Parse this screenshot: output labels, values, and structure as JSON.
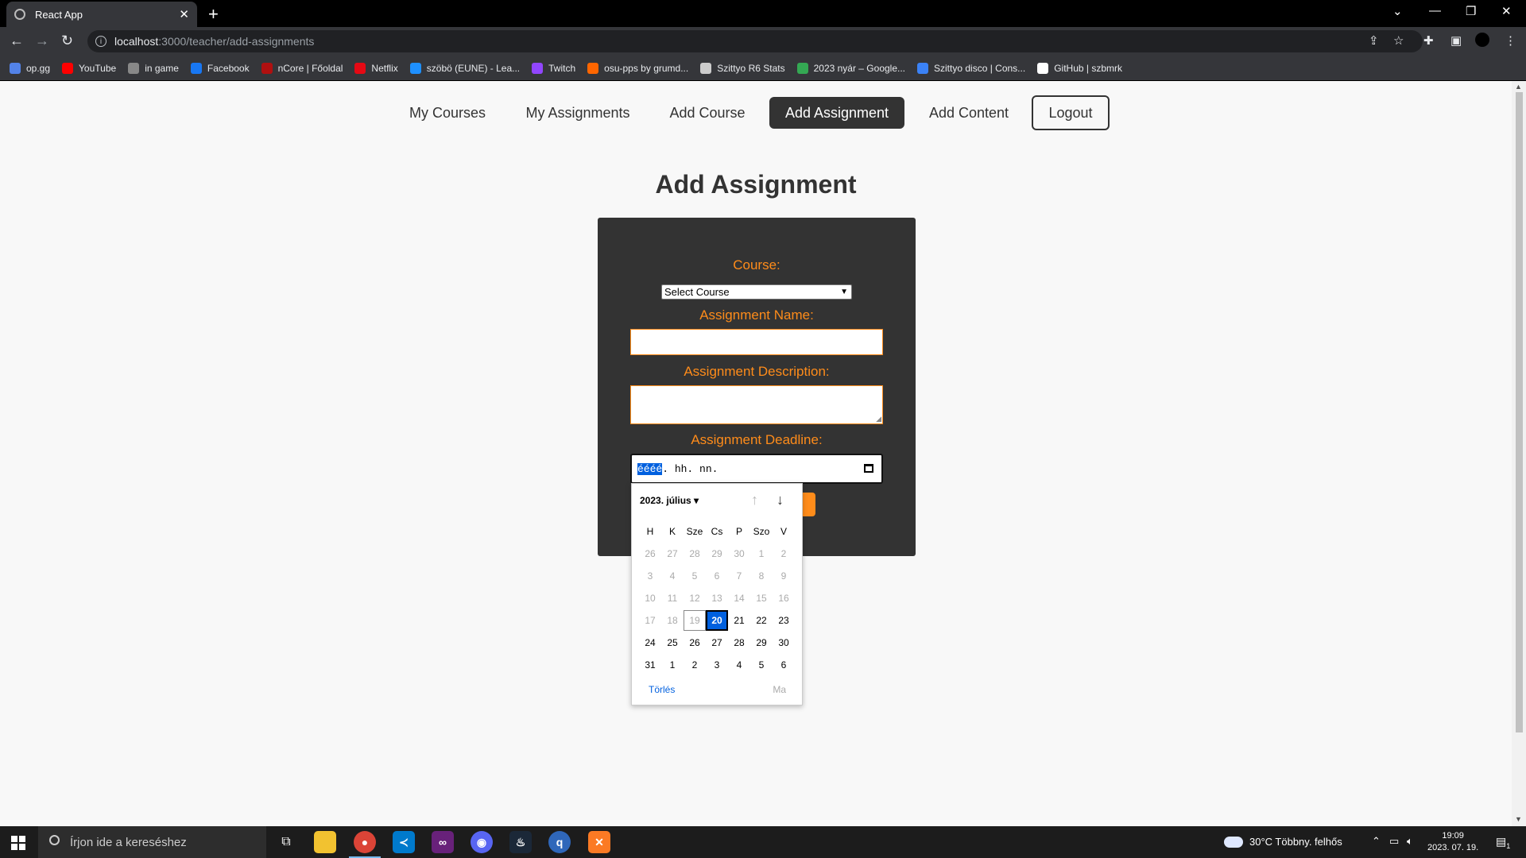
{
  "browser": {
    "tab_title": "React App",
    "url_host": "localhost",
    "url_path": ":3000/teacher/add-assignments",
    "bookmarks": [
      {
        "label": "op.gg",
        "color": "#5383e8"
      },
      {
        "label": "YouTube",
        "color": "#ff0000"
      },
      {
        "label": "in game",
        "color": "#888888"
      },
      {
        "label": "Facebook",
        "color": "#1877f2"
      },
      {
        "label": "nCore | Főoldal",
        "color": "#b01010"
      },
      {
        "label": "Netflix",
        "color": "#e50914"
      },
      {
        "label": "szöbö (EUNE) - Lea...",
        "color": "#1e90ff"
      },
      {
        "label": "Twitch",
        "color": "#9146ff"
      },
      {
        "label": "osu-pps by grumd...",
        "color": "#ff6600"
      },
      {
        "label": "Szittyo R6 Stats",
        "color": "#cccccc"
      },
      {
        "label": "2023 nyár – Google...",
        "color": "#34a853"
      },
      {
        "label": "Szittyo disco | Cons...",
        "color": "#3b82f6"
      },
      {
        "label": "GitHub | szbmrk",
        "color": "#ffffff"
      }
    ]
  },
  "nav": {
    "items": [
      {
        "label": "My Courses",
        "active": false
      },
      {
        "label": "My Assignments",
        "active": false
      },
      {
        "label": "Add Course",
        "active": false
      },
      {
        "label": "Add Assignment",
        "active": true
      },
      {
        "label": "Add Content",
        "active": false
      }
    ],
    "logout": "Logout"
  },
  "page": {
    "title": "Add Assignment"
  },
  "form": {
    "course_label": "Course:",
    "course_value": "Select Course",
    "name_label": "Assignment Name:",
    "name_value": "",
    "description_label": "Assignment Description:",
    "description_value": "",
    "deadline_label": "Assignment Deadline:",
    "deadline_year_placeholder": "éééé",
    "deadline_rest_placeholder": ". hh. nn."
  },
  "datepicker": {
    "month_label": "2023. július",
    "weekdays": [
      "H",
      "K",
      "Sze",
      "Cs",
      "P",
      "Szo",
      "V"
    ],
    "weeks": [
      [
        "26",
        "27",
        "28",
        "29",
        "30",
        "1",
        "2"
      ],
      [
        "3",
        "4",
        "5",
        "6",
        "7",
        "8",
        "9"
      ],
      [
        "10",
        "11",
        "12",
        "13",
        "14",
        "15",
        "16"
      ],
      [
        "17",
        "18",
        "19",
        "20",
        "21",
        "22",
        "23"
      ],
      [
        "24",
        "25",
        "26",
        "27",
        "28",
        "29",
        "30"
      ],
      [
        "31",
        "1",
        "2",
        "3",
        "4",
        "5",
        "6"
      ]
    ],
    "today": "19",
    "selected": "20",
    "clear_label": "Törlés",
    "today_label": "Ma"
  },
  "taskbar": {
    "search_placeholder": "Írjon ide a kereséshez",
    "weather": "30°C  Többny. felhős",
    "time": "19:09",
    "date": "2023. 07. 19.",
    "notification_count": "1"
  },
  "colors": {
    "accent": "#ff8c1a",
    "dark": "#333333",
    "picker_selected": "#0060df"
  }
}
